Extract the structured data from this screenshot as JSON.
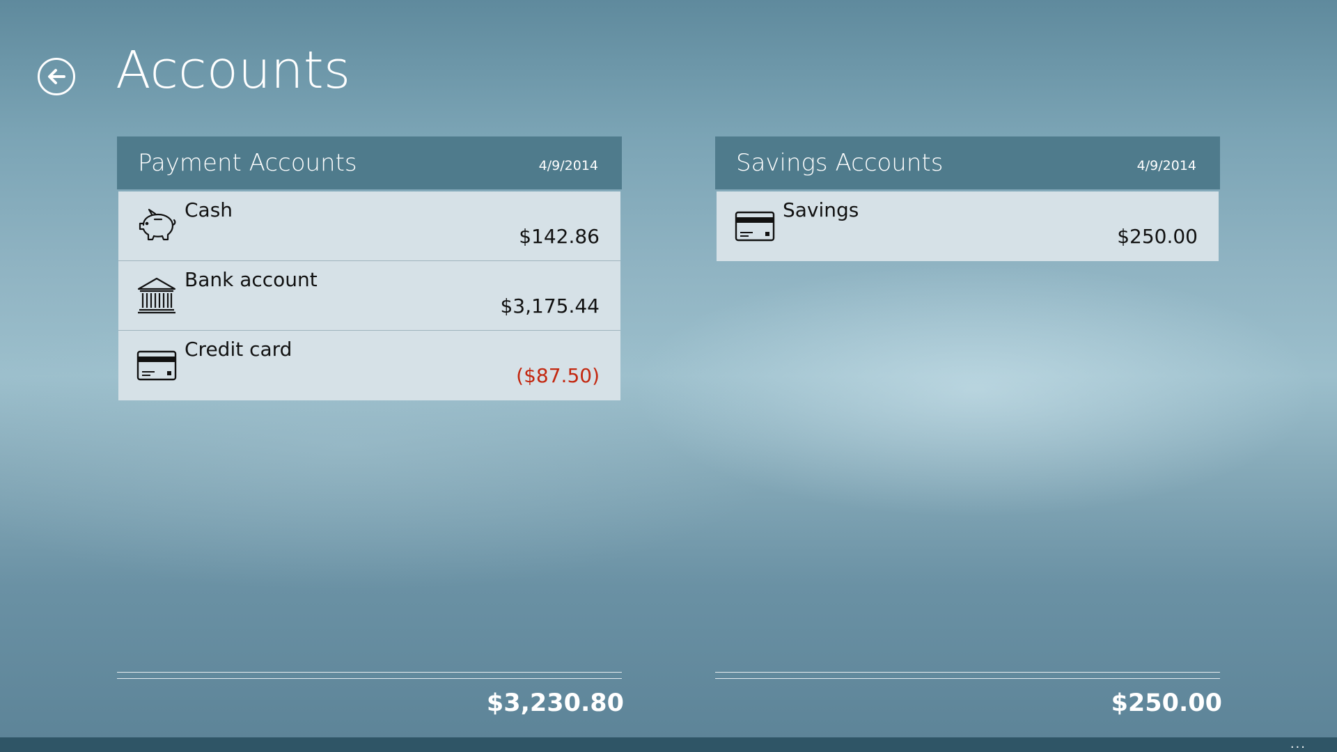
{
  "header": {
    "title": "Accounts",
    "back_icon": "back-arrow-icon"
  },
  "groups": {
    "payment": {
      "title": "Payment Accounts",
      "date": "4/9/2014",
      "items": [
        {
          "name": "Cash",
          "amount": "$142.86",
          "icon": "piggy-bank-icon"
        },
        {
          "name": "Bank account",
          "amount": "$3,175.44",
          "icon": "bank-icon"
        },
        {
          "name": "Credit card",
          "amount": "($87.50)",
          "icon": "credit-card-icon"
        }
      ],
      "total": "$3,230.80"
    },
    "savings": {
      "title": "Savings Accounts",
      "date": "4/9/2014",
      "items": [
        {
          "name": "Savings",
          "amount": "$250.00",
          "icon": "credit-card-icon"
        }
      ],
      "total": "$250.00"
    }
  },
  "app_bar": {
    "more_label": "..."
  },
  "colors": {
    "header_bg": "#4f7b8c",
    "item_bg": "#d6e1e7",
    "negative": "#c3270f",
    "app_bar": "#2f5566"
  }
}
